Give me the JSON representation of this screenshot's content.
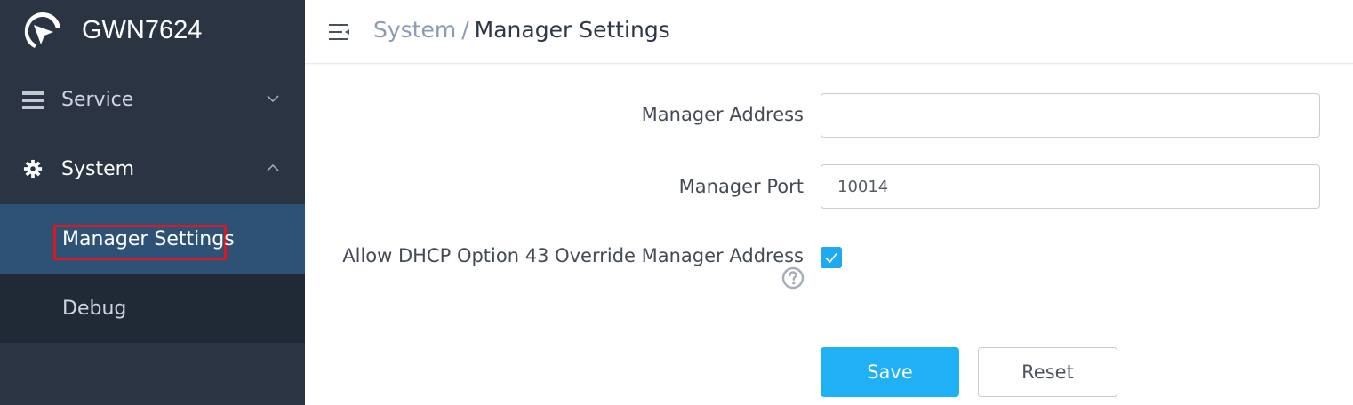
{
  "brand": {
    "name": "GWN7624",
    "logo_icon": "grandstream-logo-icon"
  },
  "sidebar": {
    "items": [
      {
        "label": "Service",
        "icon": "list-icon",
        "expanded": false
      },
      {
        "label": "System",
        "icon": "gear-icon",
        "expanded": true,
        "children": [
          {
            "label": "Manager Settings",
            "active": true
          },
          {
            "label": "Debug",
            "active": false
          }
        ]
      }
    ]
  },
  "header": {
    "breadcrumb_parent": "System",
    "breadcrumb_separator": "/",
    "breadcrumb_current": "Manager Settings"
  },
  "form": {
    "manager_address": {
      "label": "Manager Address",
      "value": ""
    },
    "manager_port": {
      "label": "Manager Port",
      "value": "10014"
    },
    "dhcp_override": {
      "label": "Allow DHCP Option 43 Override Manager Address",
      "checked": true,
      "help_icon": "question-circle-icon"
    }
  },
  "buttons": {
    "save_label": "Save",
    "reset_label": "Reset"
  },
  "colors": {
    "sidebar_bg": "#2b3443",
    "active_item_bg": "#2e5275",
    "highlight_border": "#e0161e",
    "primary": "#1fb0f6"
  }
}
